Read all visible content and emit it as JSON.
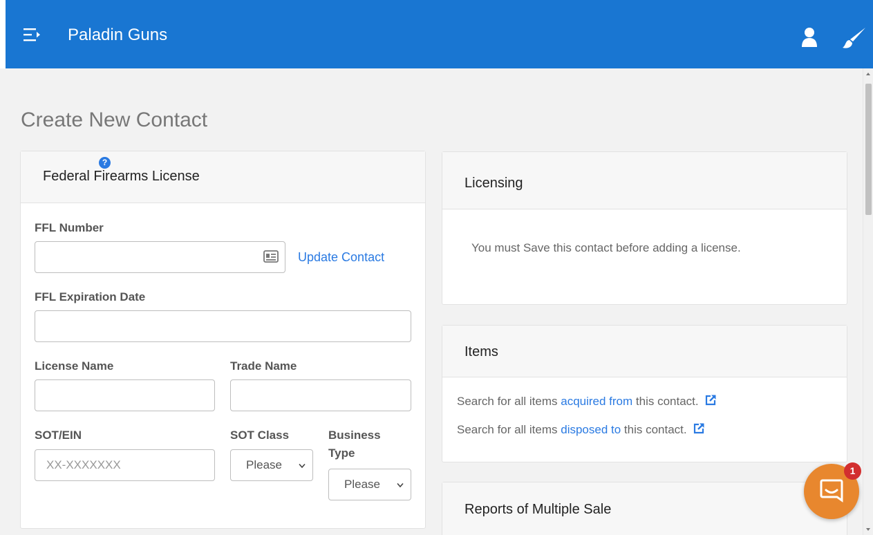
{
  "header": {
    "brand": "Paladin Guns",
    "icons": {
      "menu": "menu-collapse-icon",
      "user": "user-icon",
      "theme": "paintbrush-icon"
    },
    "color": "#1976d2"
  },
  "page": {
    "title": "Create New Contact"
  },
  "ffl_card": {
    "heading": "Federal Firearms License",
    "ffl_number_label": "FFL Number",
    "ffl_number_value": "",
    "update_contact_link": "Update Contact",
    "expiration_label": "FFL Expiration Date",
    "expiration_value": "",
    "license_name_label": "License Name",
    "license_name_value": "",
    "trade_name_label": "Trade Name",
    "trade_name_value": "",
    "sot_ein_label": "SOT/EIN",
    "sot_ein_placeholder": "XX-XXXXXXX",
    "sot_class_label": "SOT Class",
    "sot_class_selected": "Please",
    "business_type_label_line1": "Business",
    "business_type_label_line2": "Type",
    "business_type_selected": "Please"
  },
  "licensing_card": {
    "heading": "Licensing",
    "message": "You must Save this contact before adding a license."
  },
  "items_card": {
    "heading": "Items",
    "line1_prefix": "Search for all items ",
    "line1_link": "acquired from",
    "line1_suffix": " this contact.",
    "line2_prefix": "Search for all items ",
    "line2_link": "disposed to",
    "line2_suffix": " this contact."
  },
  "reports_card": {
    "heading": "Reports of Multiple Sale"
  },
  "chat": {
    "badge_count": "1",
    "color": "#e8872e"
  }
}
